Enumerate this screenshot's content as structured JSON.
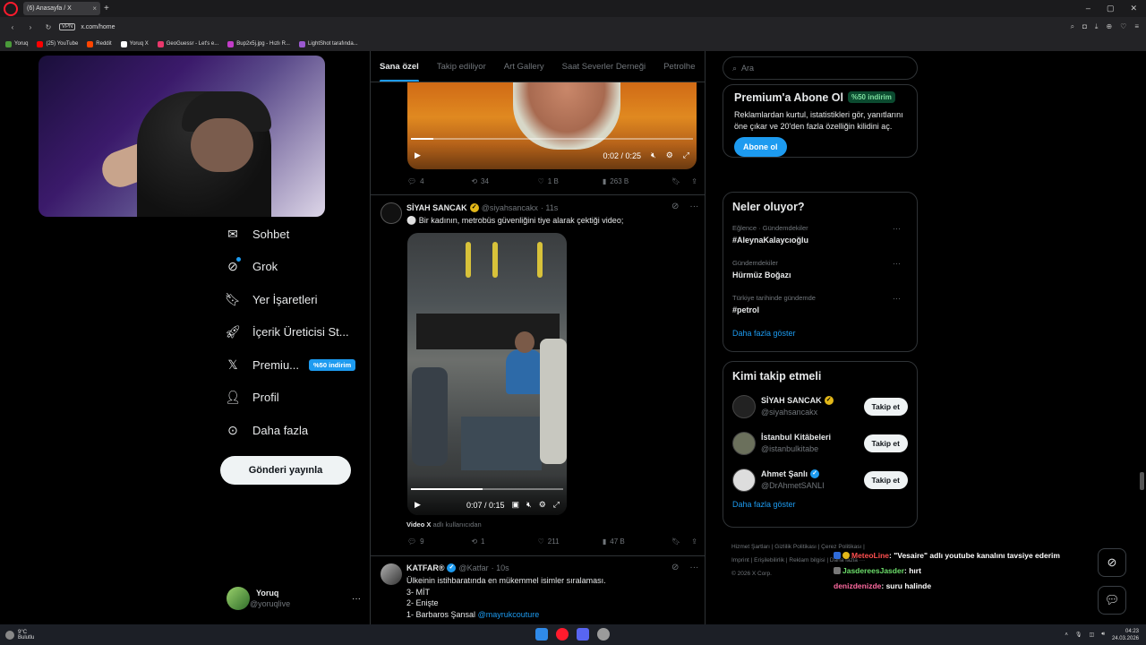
{
  "browser": {
    "tab_title": "(6) Anasayfa / X",
    "url": "x.com/home",
    "vpn_label": "VPN",
    "bookmarks": [
      {
        "label": "Yoruq",
        "color": "#4a9a3a"
      },
      {
        "label": "(25) YouTube",
        "color": "#ff0000"
      },
      {
        "label": "Reddit",
        "color": "#ff4500"
      },
      {
        "label": "Yoruq X",
        "color": "#ffffff"
      },
      {
        "label": "GeoGuessr - Let's e...",
        "color": "#e9386c"
      },
      {
        "label": "Bup2x5j.jpg - Hızlı R...",
        "color": "#c23cc8"
      },
      {
        "label": "LightShot tarafında...",
        "color": "#9b59d0"
      }
    ]
  },
  "nav": {
    "items": [
      {
        "label": "Sohbet",
        "icon": "mail-icon"
      },
      {
        "label": "Grok",
        "icon": "grok-icon"
      },
      {
        "label": "Yer İşaretleri",
        "icon": "bookmark-icon"
      },
      {
        "label": "İçerik Üreticisi St...",
        "icon": "rocket-icon"
      },
      {
        "label": "Premiu...",
        "icon": "x-logo-icon",
        "badge": "%50 indirim"
      },
      {
        "label": "Profil",
        "icon": "person-icon"
      },
      {
        "label": "Daha fazla",
        "icon": "more-circle-icon"
      }
    ],
    "post_button": "Gönderi yayınla",
    "profile": {
      "name": "Yoruq",
      "handle": "@yoruqlive",
      "more": "···"
    }
  },
  "timeline": {
    "tabs": [
      "Sana özel",
      "Takip ediliyor",
      "Art Gallery",
      "Saat Severler Derneği",
      "Petrolhe"
    ],
    "active_tab": 0,
    "tweet1": {
      "video_time": "0:02 / 0:25",
      "progress": 0.08,
      "replies": "4",
      "reposts": "34",
      "likes": "1 B",
      "views": "263 B"
    },
    "tweet2": {
      "name": "SİYAH SANCAK",
      "handle": "@siyahsancakx",
      "time": "· 11s",
      "text": "⚪ Bir kadının, metrobüs güvenliğini tiye alarak çektiği video;",
      "video_time": "0:07 / 0:15",
      "progress": 0.47,
      "caption_source": "Video X",
      "caption_rest": "adlı kullanıcıdan",
      "replies": "9",
      "reposts": "1",
      "likes": "211",
      "views": "47 B"
    },
    "tweet3": {
      "name": "KATFAR®",
      "handle": "@Katfar",
      "time": "· 10s",
      "lines": [
        "Ülkeinin istihbaratında en mükemmel isimler sıralaması.",
        "3- MİT",
        "2- Enişte"
      ],
      "last_line": "1- Barbaros Şansal",
      "mention": "@mayrukcouture"
    }
  },
  "right": {
    "search_placeholder": "Ara",
    "premium": {
      "title": "Premium'a Abone Ol",
      "badge": "%50 indirim",
      "text": "Reklamlardan kurtul, istatistikleri gör, yanıtlarını öne çıkar ve 20'den fazla özelliğin kilidini aç.",
      "button": "Abone ol"
    },
    "trends": {
      "title": "Neler oluyor?",
      "items": [
        {
          "meta": "Eğlence · Gündemdekiler",
          "title": "#AleynaKalaycıoğlu"
        },
        {
          "meta": "Gündemdekiler",
          "title": "Hürmüz Boğazı"
        },
        {
          "meta": "Türkiye tarihinde gündemde",
          "title": "#petrol"
        }
      ],
      "show_more": "Daha fazla göster"
    },
    "who_to_follow": {
      "title": "Kimi takip etmeli",
      "items": [
        {
          "name": "SİYAH SANCAK",
          "handle": "@siyahsancakx",
          "verified": "gold",
          "color": "#222"
        },
        {
          "name": "İstanbul Kitâbeleri",
          "handle": "@istanbulkitabe",
          "verified": "",
          "color": "#6b705c"
        },
        {
          "name": "Ahmet Şanlı",
          "handle": "@DrAhmetSANLI",
          "verified": "blue",
          "color": "#ddd"
        }
      ],
      "follow_label": "Takip et",
      "show_more": "Daha fazla göster"
    },
    "footer_lines": [
      "Hizmet Şartları  |  Gizlilik Politikası  |  Çerez Politikası  |",
      "Imprint  |  Erişilebilirlik  |  Reklam bilgisi  |  Daha fazla ···",
      "© 2026 X Corp."
    ]
  },
  "chat": [
    {
      "user": "MeteoLine",
      "msg": ": \"Vesaire\" adlı youtube kanalını tavsiye ederim"
    },
    {
      "user": "JasdereesJasder",
      "msg": ": hırt"
    },
    {
      "user": "denizdenizde",
      "msg": ": suru halinde"
    }
  ],
  "taskbar": {
    "weather_temp": "9°C",
    "weather_desc": "Bulutlu",
    "time": "04:23",
    "date": "24.03.2026"
  }
}
